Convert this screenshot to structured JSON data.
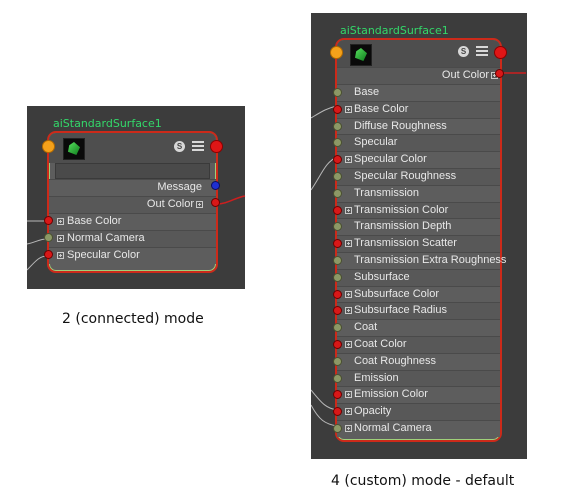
{
  "left_node": {
    "title": "aiStandardSurface1",
    "message_label": "Message",
    "out_label": "Out Color",
    "attributes": [
      "Base Color",
      "Normal Camera",
      "Specular Color"
    ],
    "caption": "2 (connected) mode"
  },
  "right_node": {
    "title": "aiStandardSurface1",
    "out_label": "Out Color",
    "attributes": [
      "Base",
      "Base Color",
      "Diffuse Roughness",
      "Specular",
      "Specular Color",
      "Specular Roughness",
      "Transmission",
      "Transmission Color",
      "Transmission Depth",
      "Transmission Scatter",
      "Transmission Extra Roughness",
      "Subsurface",
      "Subsurface Color",
      "Subsurface Radius",
      "Coat",
      "Coat Color",
      "Coat Roughness",
      "Emission",
      "Emission Color",
      "Opacity",
      "Normal Camera"
    ],
    "caption": "4 (custom) mode - default"
  },
  "badge_letter": "S"
}
